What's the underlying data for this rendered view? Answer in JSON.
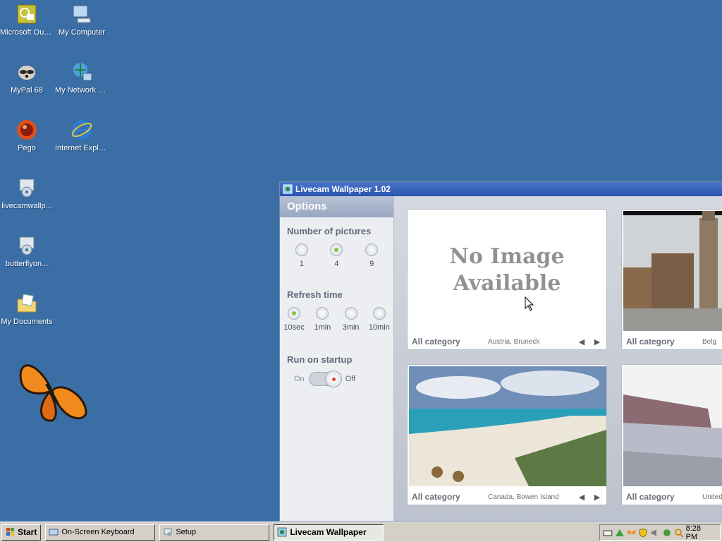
{
  "desktop": {
    "icons": [
      {
        "label": "Microsoft Outlook",
        "icon": "outlook-icon"
      },
      {
        "label": "My Computer",
        "icon": "computer-icon"
      },
      {
        "label": "MyPal 68",
        "icon": "mypal-icon"
      },
      {
        "label": "My Network Places",
        "icon": "network-icon"
      },
      {
        "label": "Pego",
        "icon": "pego-icon"
      },
      {
        "label": "Internet Explorer",
        "icon": "ie-icon"
      },
      {
        "label": "livecamwallp...",
        "icon": "installer-icon"
      },
      {
        "label": "butterflyon...",
        "icon": "installer-icon"
      },
      {
        "label": "My Documents",
        "icon": "documents-icon"
      }
    ]
  },
  "window": {
    "title": "Livecam Wallpaper 1.02",
    "options": {
      "header": "Options",
      "pictures": {
        "title": "Number of pictures",
        "choices": [
          "1",
          "4",
          "9"
        ],
        "selected": "4"
      },
      "refresh": {
        "title": "Refresh time",
        "choices": [
          "10sec",
          "1min",
          "3min",
          "10min"
        ],
        "selected": "10sec"
      },
      "startup": {
        "title": "Run on startup",
        "on_label": "On",
        "off_label": "Off",
        "state": "Off"
      }
    },
    "cards": [
      {
        "category": "All category",
        "place": "Austria, Bruneck",
        "no_image": "No Image Available",
        "image": "none"
      },
      {
        "category": "All category",
        "place": "Belg",
        "image": "town-square-photo"
      },
      {
        "category": "All category",
        "place": "Canada, Bowen Island",
        "image": "beach-photo"
      },
      {
        "category": "All category",
        "place": "United Sta",
        "image": "snowy-hills-photo"
      }
    ]
  },
  "taskbar": {
    "start_label": "Start",
    "tasks": [
      "On-Screen Keyboard",
      "Setup",
      "Livecam Wallpaper"
    ],
    "active_task": "Livecam Wallpaper",
    "clock": "8:28 PM"
  },
  "colors": {
    "desktop": "#3a6ea5",
    "title_bar": "#2a55b0",
    "selected_radio": "#7fc63a",
    "toggle_dot": "#e0403a"
  }
}
